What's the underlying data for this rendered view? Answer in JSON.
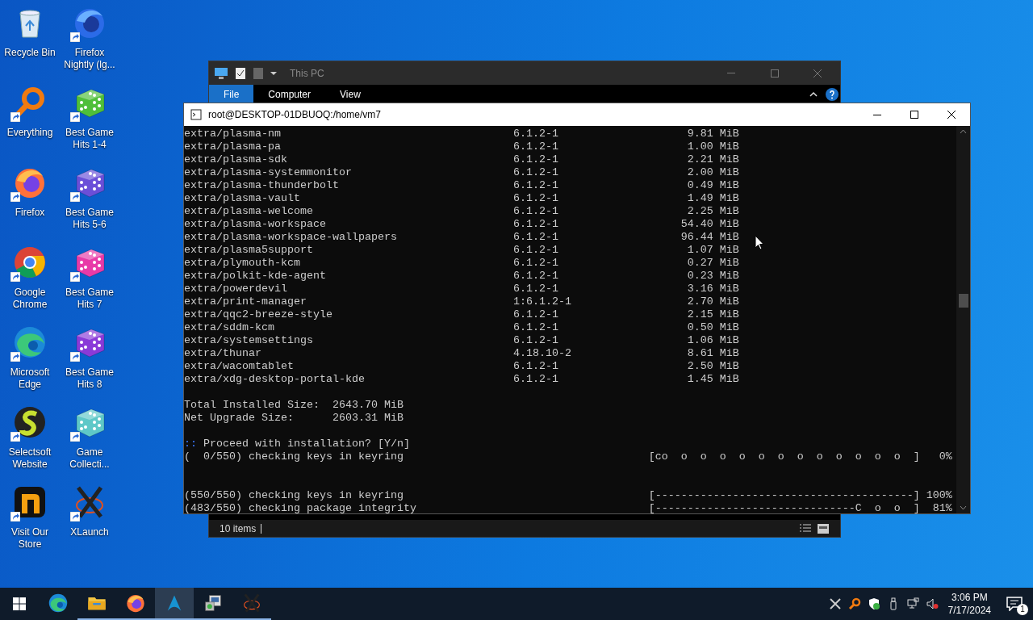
{
  "desktop_icons": [
    {
      "label": "Recycle Bin",
      "kind": "recycle-bin",
      "shortcut": false
    },
    {
      "label": "Everything",
      "kind": "magnifier",
      "shortcut": true
    },
    {
      "label": "Firefox",
      "kind": "firefox",
      "shortcut": true
    },
    {
      "label": "Google Chrome",
      "kind": "chrome",
      "shortcut": true
    },
    {
      "label": "Microsoft Edge",
      "kind": "edge",
      "shortcut": true
    },
    {
      "label": "Selectsoft Website",
      "kind": "s-logo",
      "shortcut": true
    },
    {
      "label": "Visit Our Store",
      "kind": "n-logo",
      "shortcut": true
    },
    {
      "label": "Firefox Nightly (lg...",
      "kind": "nightly",
      "shortcut": true
    },
    {
      "label": "Best Game Hits 1-4",
      "kind": "dice",
      "color": "#4fbf3a",
      "shortcut": true
    },
    {
      "label": "Best Game Hits 5-6",
      "kind": "dice",
      "color": "#6a4fd8",
      "shortcut": true
    },
    {
      "label": "Best Game Hits 7",
      "kind": "dice",
      "color": "#e83aa8",
      "shortcut": true
    },
    {
      "label": "Best Game Hits 8",
      "kind": "dice",
      "color": "#8a3ad8",
      "shortcut": true
    },
    {
      "label": "Game Collecti...",
      "kind": "dice",
      "color": "#5ec8c8",
      "shortcut": true
    },
    {
      "label": "XLaunch",
      "kind": "x-logo",
      "shortcut": true
    }
  ],
  "explorer": {
    "title": "This PC",
    "tabs": [
      {
        "label": "File",
        "selected": true
      },
      {
        "label": "Computer",
        "selected": false
      },
      {
        "label": "View",
        "selected": false
      }
    ],
    "status": "10 items"
  },
  "terminal": {
    "title": "root@DESKTOP-01DBUOQ:/home/vm7",
    "packages": [
      {
        "name": "extra/plasma-nm",
        "version": "6.1.2-1",
        "size": "9.81 MiB"
      },
      {
        "name": "extra/plasma-pa",
        "version": "6.1.2-1",
        "size": "1.00 MiB"
      },
      {
        "name": "extra/plasma-sdk",
        "version": "6.1.2-1",
        "size": "2.21 MiB"
      },
      {
        "name": "extra/plasma-systemmonitor",
        "version": "6.1.2-1",
        "size": "2.00 MiB"
      },
      {
        "name": "extra/plasma-thunderbolt",
        "version": "6.1.2-1",
        "size": "0.49 MiB"
      },
      {
        "name": "extra/plasma-vault",
        "version": "6.1.2-1",
        "size": "1.49 MiB"
      },
      {
        "name": "extra/plasma-welcome",
        "version": "6.1.2-1",
        "size": "2.25 MiB"
      },
      {
        "name": "extra/plasma-workspace",
        "version": "6.1.2-1",
        "size": "54.40 MiB"
      },
      {
        "name": "extra/plasma-workspace-wallpapers",
        "version": "6.1.2-1",
        "size": "96.44 MiB"
      },
      {
        "name": "extra/plasma5support",
        "version": "6.1.2-1",
        "size": "1.07 MiB"
      },
      {
        "name": "extra/plymouth-kcm",
        "version": "6.1.2-1",
        "size": "0.27 MiB"
      },
      {
        "name": "extra/polkit-kde-agent",
        "version": "6.1.2-1",
        "size": "0.23 MiB"
      },
      {
        "name": "extra/powerdevil",
        "version": "6.1.2-1",
        "size": "3.16 MiB"
      },
      {
        "name": "extra/print-manager",
        "version": "1:6.1.2-1",
        "size": "2.70 MiB"
      },
      {
        "name": "extra/qqc2-breeze-style",
        "version": "6.1.2-1",
        "size": "2.15 MiB"
      },
      {
        "name": "extra/sddm-kcm",
        "version": "6.1.2-1",
        "size": "0.50 MiB"
      },
      {
        "name": "extra/systemsettings",
        "version": "6.1.2-1",
        "size": "1.06 MiB"
      },
      {
        "name": "extra/thunar",
        "version": "4.18.10-2",
        "size": "8.61 MiB"
      },
      {
        "name": "extra/wacomtablet",
        "version": "6.1.2-1",
        "size": "2.50 MiB"
      },
      {
        "name": "extra/xdg-desktop-portal-kde",
        "version": "6.1.2-1",
        "size": "1.45 MiB"
      }
    ],
    "summary": [
      "Total Installed Size:  2643.70 MiB",
      "Net Upgrade Size:      2603.31 MiB"
    ],
    "prompt": {
      "mark": "::",
      "text": "Proceed with installation? [Y/n]"
    },
    "progress_before": [
      {
        "label": "(  0/550) checking keys in keyring",
        "bar": "[co  o  o  o  o  o  o  o  o  o  o  o  o  ]",
        "percent": "0%"
      }
    ],
    "progress_after": [
      {
        "label": "(550/550) checking keys in keyring",
        "bar": "[----------------------------------------]",
        "percent": "100%"
      },
      {
        "label": "(483/550) checking package integrity",
        "bar": "[-------------------------------C  o  o  ]",
        "percent": "81%"
      }
    ]
  },
  "taskbar": {
    "apps": [
      {
        "kind": "edge",
        "running": false,
        "selected": false
      },
      {
        "kind": "folder",
        "running": true,
        "selected": false
      },
      {
        "kind": "firefox",
        "running": true,
        "selected": false
      },
      {
        "kind": "arch",
        "running": true,
        "selected": true
      },
      {
        "kind": "installer",
        "running": true,
        "selected": false
      },
      {
        "kind": "x-logo",
        "running": true,
        "selected": false
      }
    ],
    "tray": [
      {
        "kind": "x-logo"
      },
      {
        "kind": "magnifier"
      },
      {
        "kind": "shield"
      },
      {
        "kind": "usb"
      },
      {
        "kind": "network"
      },
      {
        "kind": "volume-muted"
      }
    ],
    "time": "3:06 PM",
    "date": "7/17/2024",
    "notifications": "1"
  }
}
